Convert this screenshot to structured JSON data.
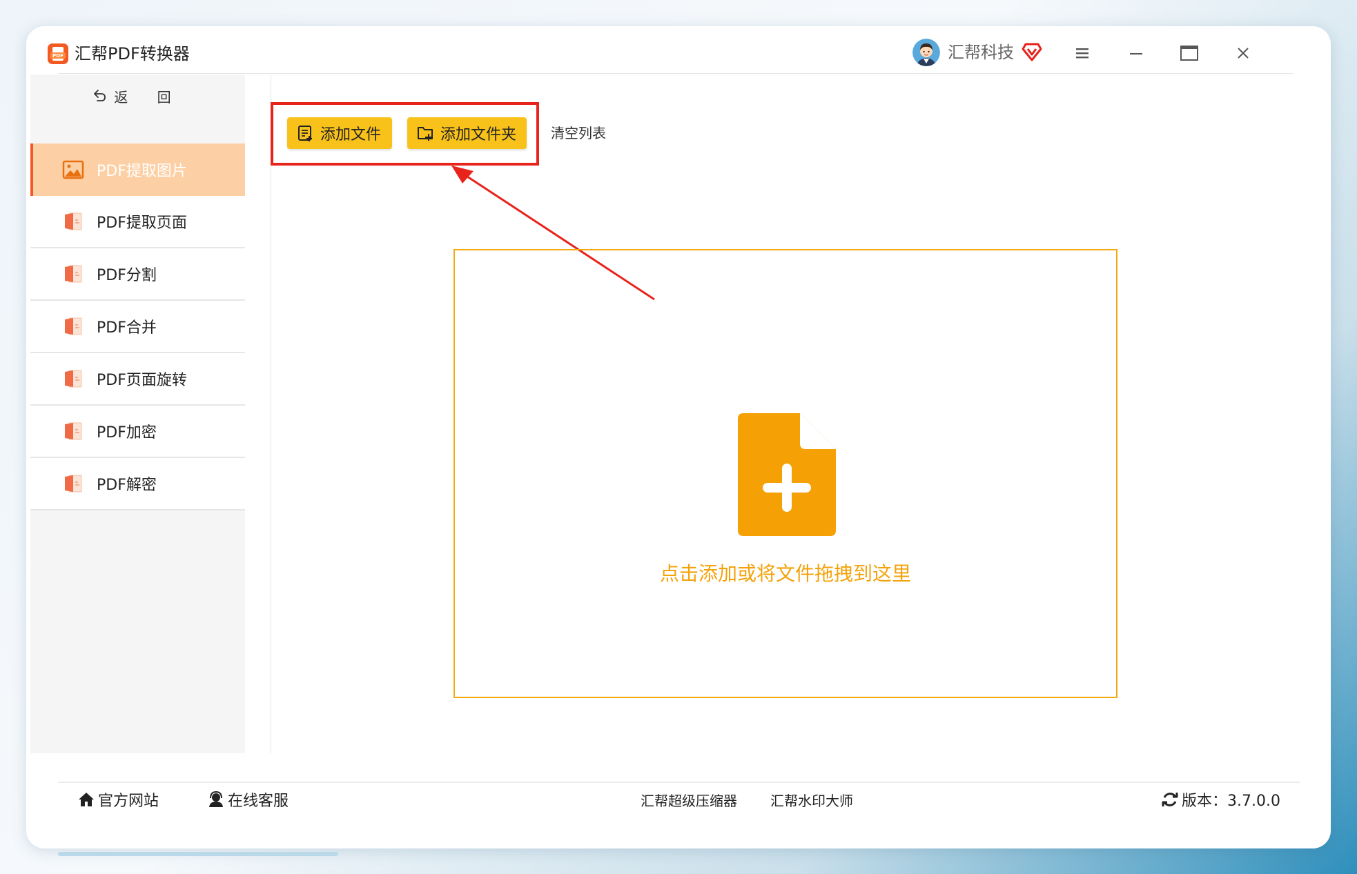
{
  "app": {
    "title": "汇帮PDF转换器",
    "user_name": "汇帮科技",
    "logo_text": "PDF"
  },
  "sidebar": {
    "back_label": "返 回",
    "items": [
      {
        "label": "PDF提取图片",
        "active": true
      },
      {
        "label": "PDF提取页面",
        "active": false
      },
      {
        "label": "PDF分割",
        "active": false
      },
      {
        "label": "PDF合并",
        "active": false
      },
      {
        "label": "PDF页面旋转",
        "active": false
      },
      {
        "label": "PDF加密",
        "active": false
      },
      {
        "label": "PDF解密",
        "active": false
      }
    ]
  },
  "toolbar": {
    "add_file_label": "添加文件",
    "add_folder_label": "添加文件夹",
    "clear_list_label": "清空列表"
  },
  "drop_zone": {
    "hint": "点击添加或将文件拖拽到这里"
  },
  "footer": {
    "website_label": "官方网站",
    "service_label": "在线客服",
    "compressor_label": "汇帮超级压缩器",
    "watermark_label": "汇帮水印大师",
    "version_label": "版本：3.7.0.0"
  },
  "colors": {
    "accent_yellow": "#f8c21b",
    "drop_orange": "#f5a910",
    "active_item_bg": "#fdcfa4",
    "active_item_border": "#f1582a",
    "highlight_red": "#e8231b"
  }
}
